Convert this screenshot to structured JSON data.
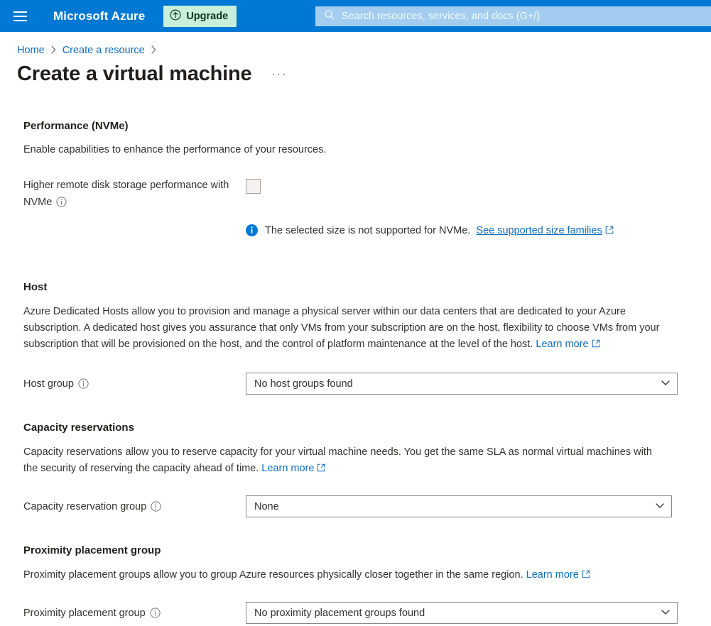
{
  "header": {
    "menu_icon": "hamburger-menu-icon",
    "brand": "Microsoft Azure",
    "upgrade_label": "Upgrade",
    "upgrade_icon": "circle-up-arrow-icon",
    "upgrade_bg": "#c8f0d9",
    "bar_color": "#0078d4",
    "search": {
      "icon": "search-icon",
      "placeholder": "Search resources, services, and docs (G+/)",
      "value": ""
    }
  },
  "breadcrumb": {
    "items": [
      {
        "label": "Home"
      },
      {
        "label": "Create a resource"
      }
    ],
    "separator": "›"
  },
  "page": {
    "title": "Create a virtual machine",
    "more_menu": "···"
  },
  "sections": {
    "performance": {
      "heading": "Performance (NVMe)",
      "description": "Enable capabilities to enhance the performance of your resources.",
      "checkbox_label": "Higher remote disk storage performance with NVMe",
      "checkbox_checked": false,
      "info_icon": "info-circle-icon",
      "message": {
        "icon": "info-filled-icon",
        "icon_color": "#0078d4",
        "text": "The selected size is not supported for NVMe.",
        "link": "See supported size families",
        "link_icon": "external-link-icon"
      }
    },
    "host": {
      "heading": "Host",
      "description": "Azure Dedicated Hosts allow you to provision and manage a physical server within our data centers that are dedicated to your Azure subscription. A dedicated host gives you assurance that only VMs from your subscription are on the host, flexibility to choose VMs from your subscription that will be provisioned on the host, and the control of platform maintenance at the level of the host.",
      "learn_more": "Learn more",
      "learn_more_icon": "external-link-icon",
      "field": {
        "label": "Host group",
        "info_icon": "info-circle-icon",
        "value": "No host groups found",
        "chevron": "chevron-down-icon"
      }
    },
    "capacity": {
      "heading": "Capacity reservations",
      "description": "Capacity reservations allow you to reserve capacity for your virtual machine needs. You get the same SLA as normal virtual machines with the security of reserving the capacity ahead of time.",
      "learn_more": "Learn more",
      "learn_more_icon": "external-link-icon",
      "field": {
        "label": "Capacity reservation group",
        "info_icon": "info-circle-icon",
        "value": "None",
        "chevron": "chevron-down-icon"
      }
    },
    "proximity": {
      "heading": "Proximity placement group",
      "description": "Proximity placement groups allow you to group Azure resources physically closer together in the same region.",
      "learn_more": "Learn more",
      "learn_more_icon": "external-link-icon",
      "field": {
        "label": "Proximity placement group",
        "info_icon": "info-circle-icon",
        "value": "No proximity placement groups found",
        "chevron": "chevron-down-icon"
      }
    }
  },
  "colors": {
    "azure_blue": "#0078d4",
    "link_blue": "#0f6cbd",
    "text": "#323130"
  }
}
